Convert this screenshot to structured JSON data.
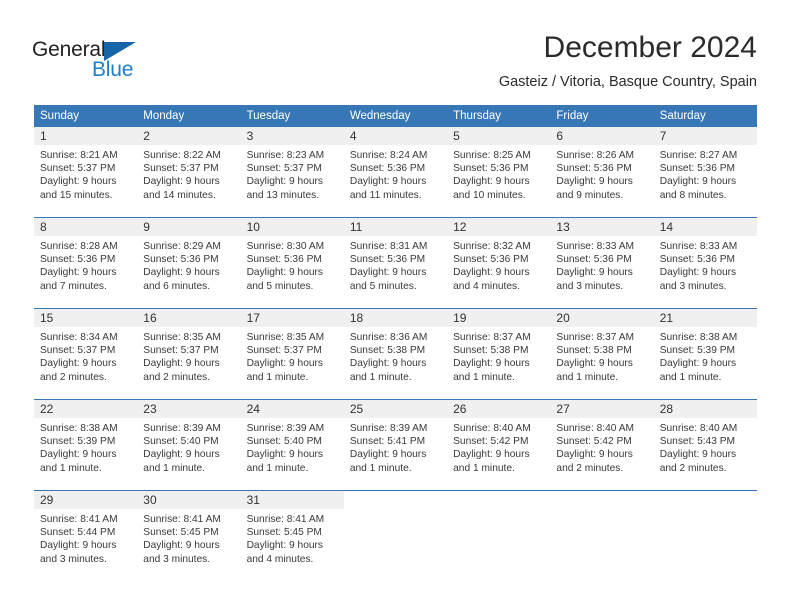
{
  "logo": {
    "word1": "General",
    "word2": "Blue",
    "triangle_color": "#1565a8",
    "word1_color": "#231f20",
    "word2_color": "#1f7fc4"
  },
  "header": {
    "month_title": "December 2024",
    "location": "Gasteiz / Vitoria, Basque Country, Spain"
  },
  "theme": {
    "header_blue": "#3877b5",
    "daynum_band": "#f0f0f0",
    "text": "#3a3a3a"
  },
  "calendar": {
    "weekday_headers": [
      "Sunday",
      "Monday",
      "Tuesday",
      "Wednesday",
      "Thursday",
      "Friday",
      "Saturday"
    ],
    "weeks": [
      [
        {
          "day": "1",
          "sunrise": "Sunrise: 8:21 AM",
          "sunset": "Sunset: 5:37 PM",
          "daylight1": "Daylight: 9 hours",
          "daylight2": "and 15 minutes."
        },
        {
          "day": "2",
          "sunrise": "Sunrise: 8:22 AM",
          "sunset": "Sunset: 5:37 PM",
          "daylight1": "Daylight: 9 hours",
          "daylight2": "and 14 minutes."
        },
        {
          "day": "3",
          "sunrise": "Sunrise: 8:23 AM",
          "sunset": "Sunset: 5:37 PM",
          "daylight1": "Daylight: 9 hours",
          "daylight2": "and 13 minutes."
        },
        {
          "day": "4",
          "sunrise": "Sunrise: 8:24 AM",
          "sunset": "Sunset: 5:36 PM",
          "daylight1": "Daylight: 9 hours",
          "daylight2": "and 11 minutes."
        },
        {
          "day": "5",
          "sunrise": "Sunrise: 8:25 AM",
          "sunset": "Sunset: 5:36 PM",
          "daylight1": "Daylight: 9 hours",
          "daylight2": "and 10 minutes."
        },
        {
          "day": "6",
          "sunrise": "Sunrise: 8:26 AM",
          "sunset": "Sunset: 5:36 PM",
          "daylight1": "Daylight: 9 hours",
          "daylight2": "and 9 minutes."
        },
        {
          "day": "7",
          "sunrise": "Sunrise: 8:27 AM",
          "sunset": "Sunset: 5:36 PM",
          "daylight1": "Daylight: 9 hours",
          "daylight2": "and 8 minutes."
        }
      ],
      [
        {
          "day": "8",
          "sunrise": "Sunrise: 8:28 AM",
          "sunset": "Sunset: 5:36 PM",
          "daylight1": "Daylight: 9 hours",
          "daylight2": "and 7 minutes."
        },
        {
          "day": "9",
          "sunrise": "Sunrise: 8:29 AM",
          "sunset": "Sunset: 5:36 PM",
          "daylight1": "Daylight: 9 hours",
          "daylight2": "and 6 minutes."
        },
        {
          "day": "10",
          "sunrise": "Sunrise: 8:30 AM",
          "sunset": "Sunset: 5:36 PM",
          "daylight1": "Daylight: 9 hours",
          "daylight2": "and 5 minutes."
        },
        {
          "day": "11",
          "sunrise": "Sunrise: 8:31 AM",
          "sunset": "Sunset: 5:36 PM",
          "daylight1": "Daylight: 9 hours",
          "daylight2": "and 5 minutes."
        },
        {
          "day": "12",
          "sunrise": "Sunrise: 8:32 AM",
          "sunset": "Sunset: 5:36 PM",
          "daylight1": "Daylight: 9 hours",
          "daylight2": "and 4 minutes."
        },
        {
          "day": "13",
          "sunrise": "Sunrise: 8:33 AM",
          "sunset": "Sunset: 5:36 PM",
          "daylight1": "Daylight: 9 hours",
          "daylight2": "and 3 minutes."
        },
        {
          "day": "14",
          "sunrise": "Sunrise: 8:33 AM",
          "sunset": "Sunset: 5:36 PM",
          "daylight1": "Daylight: 9 hours",
          "daylight2": "and 3 minutes."
        }
      ],
      [
        {
          "day": "15",
          "sunrise": "Sunrise: 8:34 AM",
          "sunset": "Sunset: 5:37 PM",
          "daylight1": "Daylight: 9 hours",
          "daylight2": "and 2 minutes."
        },
        {
          "day": "16",
          "sunrise": "Sunrise: 8:35 AM",
          "sunset": "Sunset: 5:37 PM",
          "daylight1": "Daylight: 9 hours",
          "daylight2": "and 2 minutes."
        },
        {
          "day": "17",
          "sunrise": "Sunrise: 8:35 AM",
          "sunset": "Sunset: 5:37 PM",
          "daylight1": "Daylight: 9 hours",
          "daylight2": "and 1 minute."
        },
        {
          "day": "18",
          "sunrise": "Sunrise: 8:36 AM",
          "sunset": "Sunset: 5:38 PM",
          "daylight1": "Daylight: 9 hours",
          "daylight2": "and 1 minute."
        },
        {
          "day": "19",
          "sunrise": "Sunrise: 8:37 AM",
          "sunset": "Sunset: 5:38 PM",
          "daylight1": "Daylight: 9 hours",
          "daylight2": "and 1 minute."
        },
        {
          "day": "20",
          "sunrise": "Sunrise: 8:37 AM",
          "sunset": "Sunset: 5:38 PM",
          "daylight1": "Daylight: 9 hours",
          "daylight2": "and 1 minute."
        },
        {
          "day": "21",
          "sunrise": "Sunrise: 8:38 AM",
          "sunset": "Sunset: 5:39 PM",
          "daylight1": "Daylight: 9 hours",
          "daylight2": "and 1 minute."
        }
      ],
      [
        {
          "day": "22",
          "sunrise": "Sunrise: 8:38 AM",
          "sunset": "Sunset: 5:39 PM",
          "daylight1": "Daylight: 9 hours",
          "daylight2": "and 1 minute."
        },
        {
          "day": "23",
          "sunrise": "Sunrise: 8:39 AM",
          "sunset": "Sunset: 5:40 PM",
          "daylight1": "Daylight: 9 hours",
          "daylight2": "and 1 minute."
        },
        {
          "day": "24",
          "sunrise": "Sunrise: 8:39 AM",
          "sunset": "Sunset: 5:40 PM",
          "daylight1": "Daylight: 9 hours",
          "daylight2": "and 1 minute."
        },
        {
          "day": "25",
          "sunrise": "Sunrise: 8:39 AM",
          "sunset": "Sunset: 5:41 PM",
          "daylight1": "Daylight: 9 hours",
          "daylight2": "and 1 minute."
        },
        {
          "day": "26",
          "sunrise": "Sunrise: 8:40 AM",
          "sunset": "Sunset: 5:42 PM",
          "daylight1": "Daylight: 9 hours",
          "daylight2": "and 1 minute."
        },
        {
          "day": "27",
          "sunrise": "Sunrise: 8:40 AM",
          "sunset": "Sunset: 5:42 PM",
          "daylight1": "Daylight: 9 hours",
          "daylight2": "and 2 minutes."
        },
        {
          "day": "28",
          "sunrise": "Sunrise: 8:40 AM",
          "sunset": "Sunset: 5:43 PM",
          "daylight1": "Daylight: 9 hours",
          "daylight2": "and 2 minutes."
        }
      ],
      [
        {
          "day": "29",
          "sunrise": "Sunrise: 8:41 AM",
          "sunset": "Sunset: 5:44 PM",
          "daylight1": "Daylight: 9 hours",
          "daylight2": "and 3 minutes."
        },
        {
          "day": "30",
          "sunrise": "Sunrise: 8:41 AM",
          "sunset": "Sunset: 5:45 PM",
          "daylight1": "Daylight: 9 hours",
          "daylight2": "and 3 minutes."
        },
        {
          "day": "31",
          "sunrise": "Sunrise: 8:41 AM",
          "sunset": "Sunset: 5:45 PM",
          "daylight1": "Daylight: 9 hours",
          "daylight2": "and 4 minutes."
        },
        {
          "day": "",
          "sunrise": "",
          "sunset": "",
          "daylight1": "",
          "daylight2": ""
        },
        {
          "day": "",
          "sunrise": "",
          "sunset": "",
          "daylight1": "",
          "daylight2": ""
        },
        {
          "day": "",
          "sunrise": "",
          "sunset": "",
          "daylight1": "",
          "daylight2": ""
        },
        {
          "day": "",
          "sunrise": "",
          "sunset": "",
          "daylight1": "",
          "daylight2": ""
        }
      ]
    ]
  }
}
